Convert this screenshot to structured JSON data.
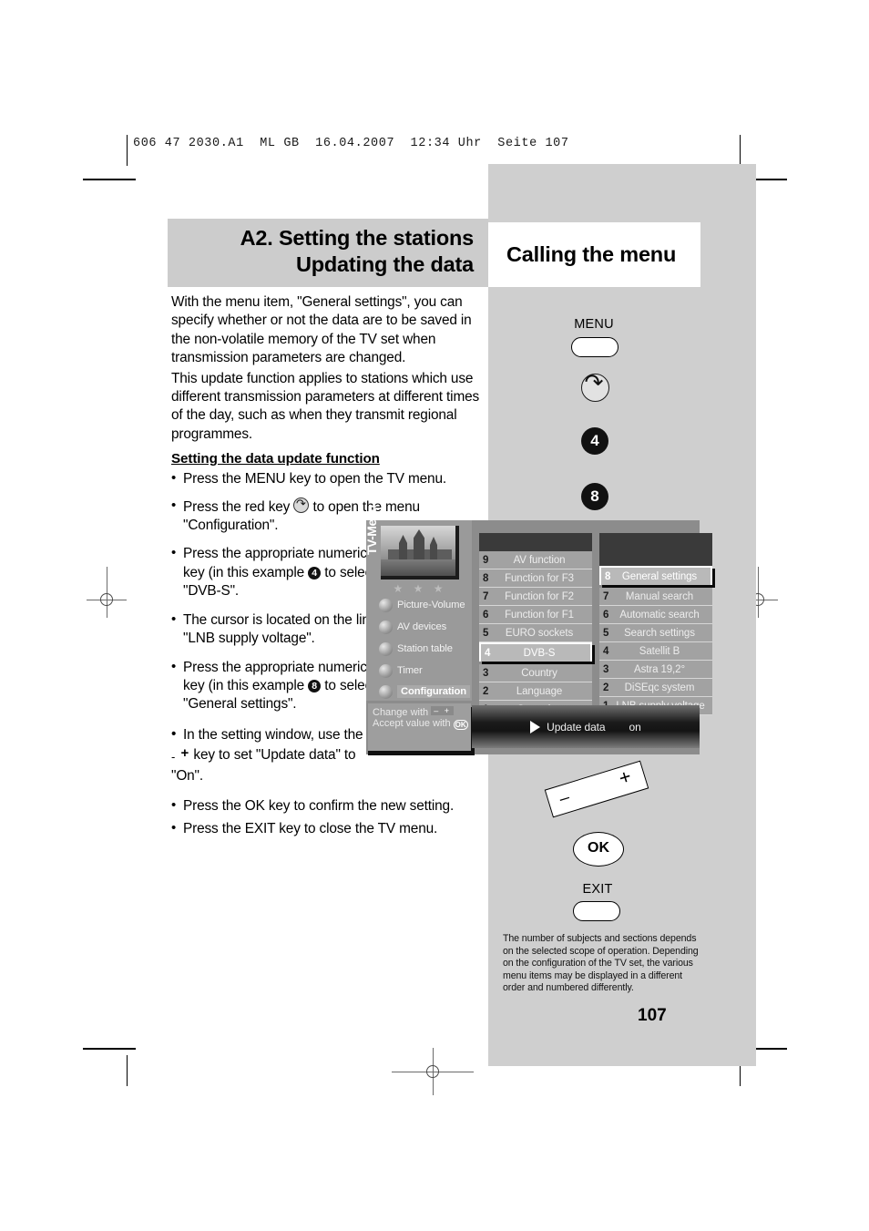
{
  "print": {
    "slug": "606 47 2030.A1  ML GB  16.04.2007  12:34 Uhr  Seite 107"
  },
  "header": {
    "title_line1": "A2. Setting the stations",
    "title_line2": "Updating the data",
    "right_title": "Calling the menu"
  },
  "body": {
    "paragraph1": "With the menu item, \"General settings\", you can specify whether or not the data are to be saved in the non-volatile memory of the TV set when transmission parameters are changed.",
    "paragraph2": "This update function applies to stations which use different transmission parameters at different times of the day, such as when they transmit regional programmes.",
    "subhead": "Setting the data update function",
    "step1": "Press the MENU key to open the TV menu.",
    "step2_a": "Press the red key",
    "step2_b": "to open the menu \"Configuration\".",
    "step3_a": "Press the appropriate numeric key (in this example",
    "step3_key": "4",
    "step3_b": "to select \"DVB-S\".",
    "step4": "The cursor is located on the line \"LNB supply voltage\".",
    "step5_a": "Press the appropriate numeric key (in this example",
    "step5_key": "8",
    "step5_b": "to select \"General settings\".",
    "step6_a": "In the setting window, use the",
    "step6_b": "key to set \"Update data\" to \"On\".",
    "step7": "Press the OK key to confirm the new setting.",
    "step8": "Press the EXIT key to close the TV menu."
  },
  "osd": {
    "menu_label": "TV-Menu",
    "stars": "★ ★ ★",
    "main_items": [
      {
        "label": "Picture-Volume",
        "selected": false
      },
      {
        "label": "AV devices",
        "selected": false
      },
      {
        "label": "Station table",
        "selected": false
      },
      {
        "label": "Timer",
        "selected": false
      },
      {
        "label": "Configuration",
        "selected": true
      }
    ],
    "column_a": [
      {
        "num": "9",
        "label": "AV function",
        "selected": false
      },
      {
        "num": "8",
        "label": "Function for F3",
        "selected": false
      },
      {
        "num": "7",
        "label": "Function for F2",
        "selected": false
      },
      {
        "num": "6",
        "label": "Function for F1",
        "selected": false
      },
      {
        "num": "5",
        "label": "EURO sockets",
        "selected": false
      },
      {
        "num": "4",
        "label": "DVB-S",
        "selected": true
      },
      {
        "num": "3",
        "label": "Country",
        "selected": false
      },
      {
        "num": "2",
        "label": "Language",
        "selected": false
      },
      {
        "num": "1",
        "label": "Operating",
        "selected": false
      }
    ],
    "column_b": [
      {
        "num": "8",
        "label": "General settings",
        "selected": true
      },
      {
        "num": "7",
        "label": "Manual search",
        "selected": false
      },
      {
        "num": "6",
        "label": "Automatic search",
        "selected": false
      },
      {
        "num": "5",
        "label": "Search settings",
        "selected": false
      },
      {
        "num": "4",
        "label": "Satellit B",
        "selected": false
      },
      {
        "num": "3",
        "label": "Astra 19,2°",
        "selected": false
      },
      {
        "num": "2",
        "label": "DiSEqc system",
        "selected": false
      },
      {
        "num": "1",
        "label": "LNB supply voltage",
        "selected": false
      }
    ],
    "info_line1": "Change with",
    "info_line2": "Accept value with",
    "info_ok": "OK",
    "info_pm": "– +",
    "value_label": "Update data",
    "value_value": "on"
  },
  "keys": {
    "menu_label": "MENU",
    "red_key_icon": "return-arrow-icon",
    "num_key_4": "4",
    "num_key_8": "8",
    "rocker_minus": "–",
    "rocker_plus": "+",
    "ok_label": "OK",
    "exit_label": "EXIT"
  },
  "footnote": "The number of subjects and sections depends on the selected scope of operation. Depending on the configuration of the TV set, the various menu items may be displayed in a different order and numbered differently.",
  "page_number": "107",
  "colors": {
    "panel_gray": "#cfcfcf",
    "title_gray": "#cccccc",
    "osd_gray": "#8c8c8c"
  }
}
